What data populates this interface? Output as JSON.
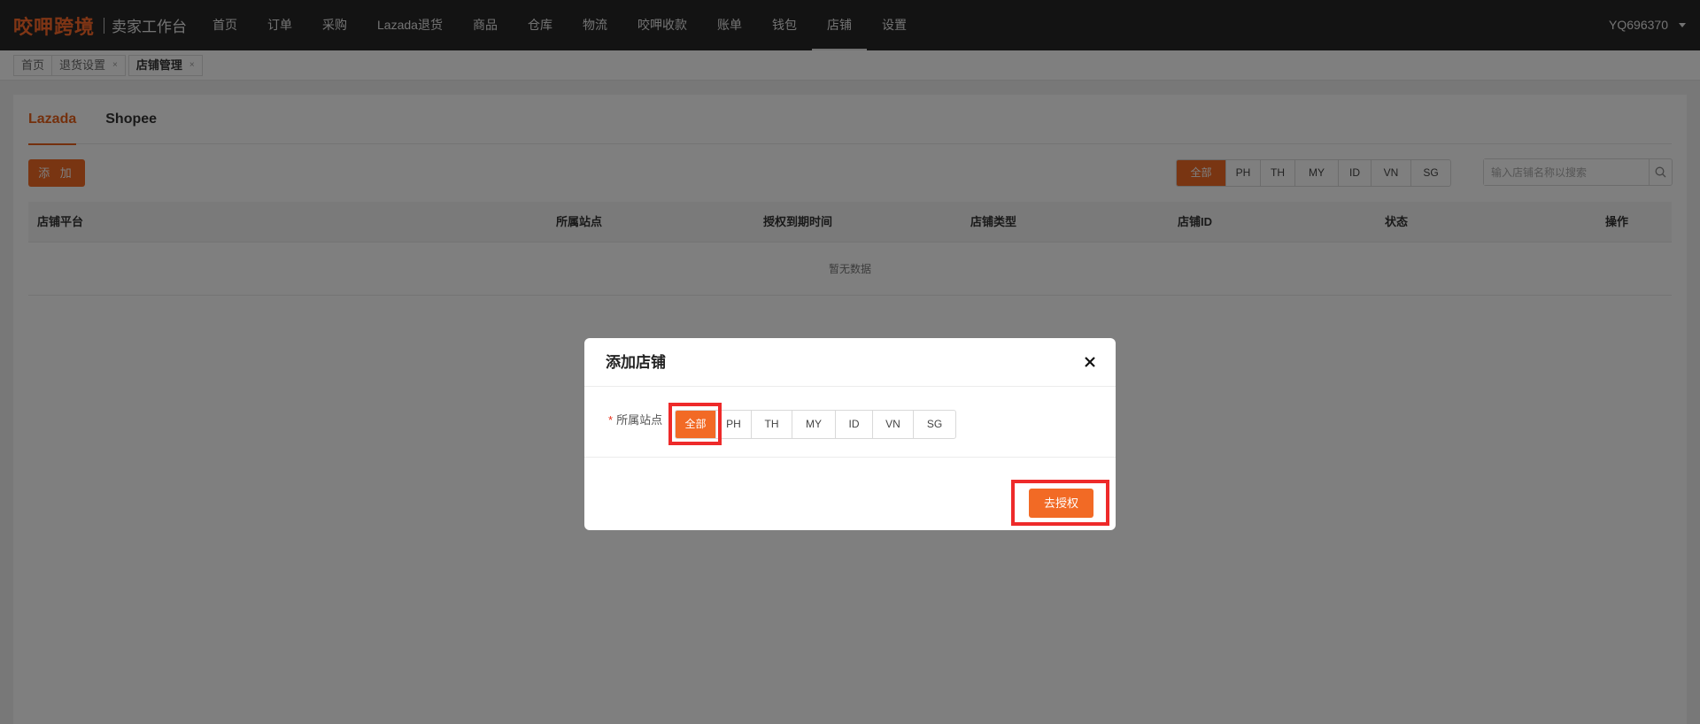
{
  "header": {
    "brand": "咬呷跨境",
    "subtitle": "卖家工作台",
    "nav": [
      {
        "label": "首页"
      },
      {
        "label": "订单"
      },
      {
        "label": "采购"
      },
      {
        "label": "Lazada退货"
      },
      {
        "label": "商品"
      },
      {
        "label": "仓库"
      },
      {
        "label": "物流"
      },
      {
        "label": "咬呷收款"
      },
      {
        "label": "账单"
      },
      {
        "label": "钱包"
      },
      {
        "label": "店铺",
        "active": true
      },
      {
        "label": "设置"
      }
    ],
    "user": "YQ696370"
  },
  "breadcrumb_tabs": [
    {
      "label": "首页"
    },
    {
      "label": "退货设置",
      "close": "×"
    },
    {
      "label": "店铺管理",
      "close": "×",
      "active": true
    }
  ],
  "platform_tabs": [
    {
      "label": "Lazada",
      "active": true
    },
    {
      "label": "Shopee"
    }
  ],
  "add_button": "添 加",
  "site_filter": [
    "全部",
    "PH",
    "TH",
    "MY",
    "ID",
    "VN",
    "SG"
  ],
  "site_filter_selected": "全部",
  "search": {
    "placeholder": "输入店铺名称以搜索",
    "value": ""
  },
  "table": {
    "columns": [
      "店铺平台",
      "所属站点",
      "授权到期时间",
      "店铺类型",
      "店铺ID",
      "状态",
      "操作"
    ],
    "empty_text": "暂无数据"
  },
  "modal": {
    "title": "添加店铺",
    "required_mark": "*",
    "field_label": "所属站点",
    "sites": [
      "全部",
      "PH",
      "TH",
      "MY",
      "ID",
      "VN",
      "SG"
    ],
    "selected_site": "全部",
    "confirm_button": "去授权"
  },
  "colors": {
    "accent": "#f26a25",
    "nav_bg": "#262626",
    "highlight": "#ee2a2a"
  }
}
